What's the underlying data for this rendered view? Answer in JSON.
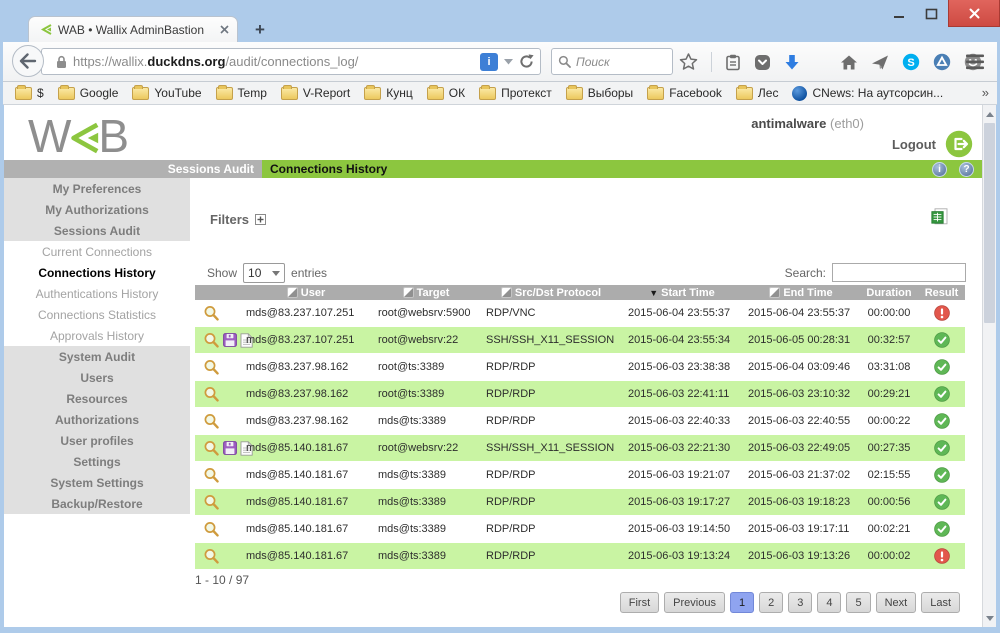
{
  "colors": {
    "wab_green": "#8CC63F",
    "row_green": "#C9F4A3",
    "header_gray": "#ACACAC",
    "active_page_blue": "#8FA4F0",
    "ok_green": "#5FB756",
    "error_red": "#E2574C"
  },
  "browser": {
    "tab_title": "WAB • Wallix AdminBastion",
    "new_tab_label": "+",
    "url": {
      "prefix": "https://wallix.",
      "domain": "duckdns.org",
      "path": "/audit/connections_log/"
    },
    "search_placeholder": "Поиск",
    "bookmarks": [
      "$",
      "Google",
      "YouTube",
      "Temp",
      "V-Report",
      "Кунц",
      "ОК",
      "Протекст",
      "Выборы",
      "Facebook",
      "Лес"
    ],
    "bookmark_page": "CNews: На аутсорсин...",
    "bookmarks_overflow": "»"
  },
  "app": {
    "logo": {
      "w": "W",
      "b": "B"
    },
    "user": "antimalware",
    "interface": "(eth0)",
    "logout_label": "Logout",
    "nav": {
      "section": "Sessions Audit",
      "active_tab": "Connections History"
    },
    "sidebar": {
      "top_sections": [
        "My Preferences",
        "My Authorizations",
        "Sessions Audit"
      ],
      "sessions_audit_items": [
        "Current Connections",
        "Connections History",
        "Authentications History",
        "Connections Statistics",
        "Approvals History"
      ],
      "active_item": "Connections History",
      "system_sections": [
        "System Audit",
        "Users",
        "Resources",
        "Authorizations",
        "User profiles",
        "Settings",
        "System Settings",
        "Backup/Restore"
      ]
    },
    "filters_label": "Filters",
    "show_label": "Show",
    "page_size": "10",
    "entries_label": "entries",
    "search_label": "Search:",
    "table": {
      "columns": [
        {
          "label": "",
          "sort": "none"
        },
        {
          "label": "User",
          "sort": "both"
        },
        {
          "label": "Target",
          "sort": "both"
        },
        {
          "label": "Src/Dst Protocol",
          "sort": "both"
        },
        {
          "label": "Start Time",
          "sort": "desc"
        },
        {
          "label": "End Time",
          "sort": "both"
        },
        {
          "label": "Duration",
          "sort": "none"
        },
        {
          "label": "Result",
          "sort": "none"
        }
      ],
      "rows": [
        {
          "icons": [
            "zoom"
          ],
          "user": "mds@83.237.107.251",
          "target": "root@websrv:5900",
          "protocol": "RDP/VNC",
          "start": "2015-06-04 23:55:37",
          "end": "2015-06-04 23:55:37",
          "duration": "00:00:00",
          "result": "error"
        },
        {
          "icons": [
            "zoom",
            "save",
            "doc"
          ],
          "user": "mds@83.237.107.251",
          "target": "root@websrv:22",
          "protocol": "SSH/SSH_X11_SESSION",
          "start": "2015-06-04 23:55:34",
          "end": "2015-06-05 00:28:31",
          "duration": "00:32:57",
          "result": "ok"
        },
        {
          "icons": [
            "zoom"
          ],
          "user": "mds@83.237.98.162",
          "target": "root@ts:3389",
          "protocol": "RDP/RDP",
          "start": "2015-06-03 23:38:38",
          "end": "2015-06-04 03:09:46",
          "duration": "03:31:08",
          "result": "ok"
        },
        {
          "icons": [
            "zoom"
          ],
          "user": "mds@83.237.98.162",
          "target": "root@ts:3389",
          "protocol": "RDP/RDP",
          "start": "2015-06-03 22:41:11",
          "end": "2015-06-03 23:10:32",
          "duration": "00:29:21",
          "result": "ok"
        },
        {
          "icons": [
            "zoom"
          ],
          "user": "mds@83.237.98.162",
          "target": "mds@ts:3389",
          "protocol": "RDP/RDP",
          "start": "2015-06-03 22:40:33",
          "end": "2015-06-03 22:40:55",
          "duration": "00:00:22",
          "result": "ok"
        },
        {
          "icons": [
            "zoom",
            "save",
            "doc"
          ],
          "user": "mds@85.140.181.67",
          "target": "root@websrv:22",
          "protocol": "SSH/SSH_X11_SESSION",
          "start": "2015-06-03 22:21:30",
          "end": "2015-06-03 22:49:05",
          "duration": "00:27:35",
          "result": "ok"
        },
        {
          "icons": [
            "zoom"
          ],
          "user": "mds@85.140.181.67",
          "target": "mds@ts:3389",
          "protocol": "RDP/RDP",
          "start": "2015-06-03 19:21:07",
          "end": "2015-06-03 21:37:02",
          "duration": "02:15:55",
          "result": "ok"
        },
        {
          "icons": [
            "zoom"
          ],
          "user": "mds@85.140.181.67",
          "target": "mds@ts:3389",
          "protocol": "RDP/RDP",
          "start": "2015-06-03 19:17:27",
          "end": "2015-06-03 19:18:23",
          "duration": "00:00:56",
          "result": "ok"
        },
        {
          "icons": [
            "zoom"
          ],
          "user": "mds@85.140.181.67",
          "target": "mds@ts:3389",
          "protocol": "RDP/RDP",
          "start": "2015-06-03 19:14:50",
          "end": "2015-06-03 19:17:11",
          "duration": "00:02:21",
          "result": "ok"
        },
        {
          "icons": [
            "zoom"
          ],
          "user": "mds@85.140.181.67",
          "target": "mds@ts:3389",
          "protocol": "RDP/RDP",
          "start": "2015-06-03 19:13:24",
          "end": "2015-06-03 19:13:26",
          "duration": "00:00:02",
          "result": "error"
        }
      ]
    },
    "range_label": "1 - 10 / 97",
    "pagination": {
      "buttons": [
        "First",
        "Previous",
        "1",
        "2",
        "3",
        "4",
        "5",
        "Next",
        "Last"
      ],
      "active": "1"
    }
  }
}
